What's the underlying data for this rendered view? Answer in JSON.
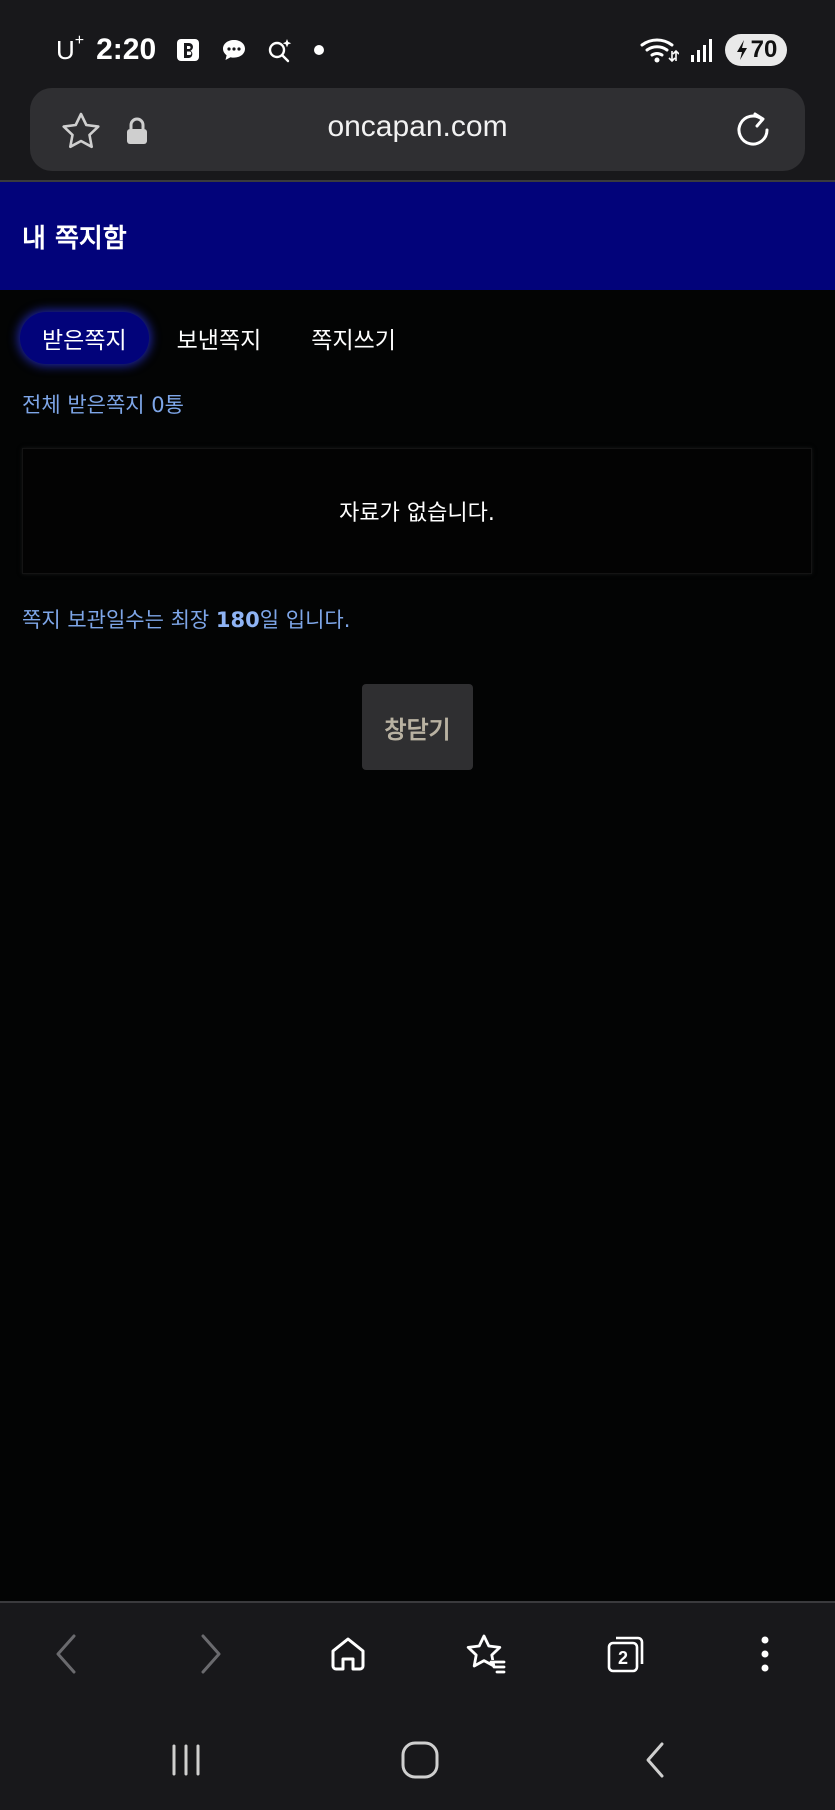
{
  "status_bar": {
    "carrier": "U",
    "carrier_sup": "+",
    "time": "2:20",
    "battery_level": "70"
  },
  "browser": {
    "url": "oncapan.com",
    "tab_count": "2"
  },
  "page": {
    "title": "내 쪽지함",
    "tabs": [
      {
        "label": "받은쪽지",
        "active": true
      },
      {
        "label": "보낸쪽지",
        "active": false
      },
      {
        "label": "쪽지쓰기",
        "active": false
      }
    ],
    "total_count_text": "전체 받은쪽지 0통",
    "empty_message": "자료가 없습니다.",
    "retention_prefix": "쪽지 보관일수는 최장 ",
    "retention_days": "180",
    "retention_suffix": "일 입니다.",
    "close_button": "창닫기"
  },
  "colors": {
    "header_bg": "#02037a",
    "link_text": "#7ea6e8",
    "chrome_bg": "#18181b"
  },
  "icons": {
    "status": [
      "bold-b-icon",
      "chat-icon",
      "assistant-icon",
      "dot-icon",
      "wifi-icon",
      "signal-icon",
      "battery-charging-icon"
    ],
    "url_bar": [
      "star-icon",
      "lock-icon",
      "reload-icon"
    ],
    "toolbar": [
      "back-icon",
      "forward-icon",
      "home-icon",
      "bookmarks-icon",
      "tabs-icon",
      "more-icon"
    ],
    "system_nav": [
      "recents-icon",
      "home-nav-icon",
      "back-nav-icon"
    ]
  }
}
